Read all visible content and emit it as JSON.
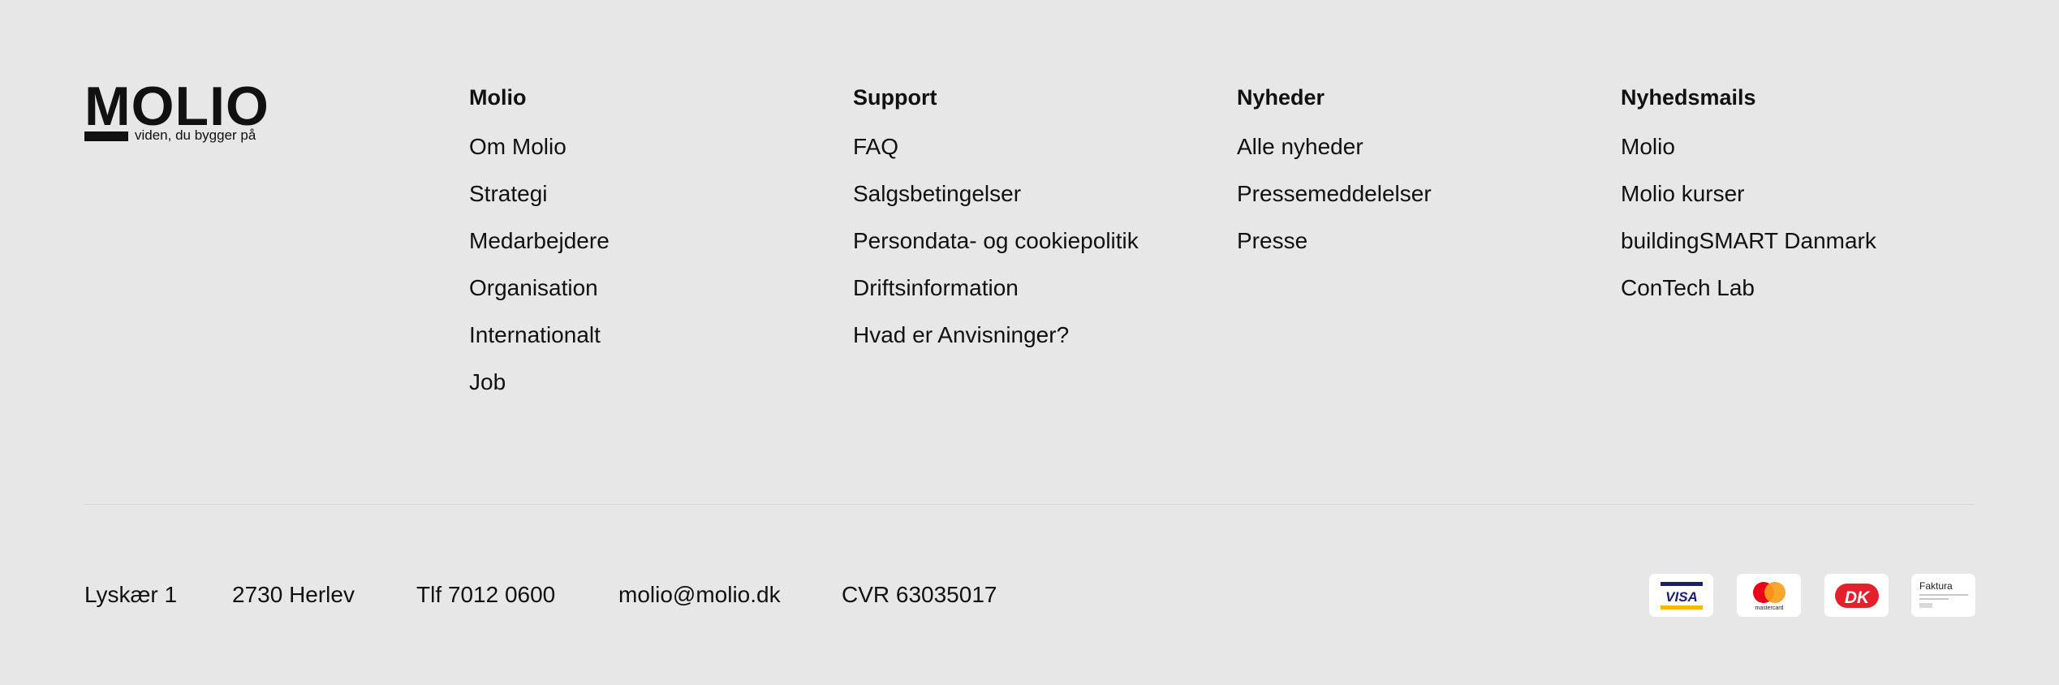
{
  "logo": {
    "word": "MOLIO",
    "tagline": "viden, du bygger på"
  },
  "columns": [
    {
      "title": "Molio",
      "links": [
        "Om Molio",
        "Strategi",
        "Medarbejdere",
        "Organisation",
        "Internationalt",
        "Job"
      ]
    },
    {
      "title": "Support",
      "links": [
        "FAQ",
        "Salgsbetingelser",
        "Persondata- og cookiepolitik",
        "Driftsinformation",
        "Hvad er Anvisninger?"
      ]
    },
    {
      "title": "Nyheder",
      "links": [
        "Alle nyheder",
        "Pressemeddelelser",
        "Presse"
      ]
    },
    {
      "title": "Nyhedsmails",
      "links": [
        "Molio",
        "Molio kurser",
        "buildingSMART Danmark",
        "ConTech Lab"
      ]
    }
  ],
  "contact": {
    "address": "Lyskær 1",
    "city": "2730 Herlev",
    "phone": "Tlf 7012 0600",
    "email": "molio@molio.dk",
    "cvr": "CVR 63035017"
  },
  "payment": {
    "visa_label": "VISA",
    "mastercard_label": "mastercard",
    "dankort_label": "DK",
    "faktura_label": "Faktura",
    "icons": [
      "visa-icon",
      "mastercard-icon",
      "dankort-icon",
      "faktura-icon"
    ]
  },
  "colors": {
    "background": "#e7e7e7",
    "text": "#111111",
    "visa_blue": "#1a1f71",
    "visa_gold": "#f7b600",
    "mc_red": "#eb001b",
    "mc_orange": "#f79e1b",
    "dankort_red": "#e4202c"
  }
}
